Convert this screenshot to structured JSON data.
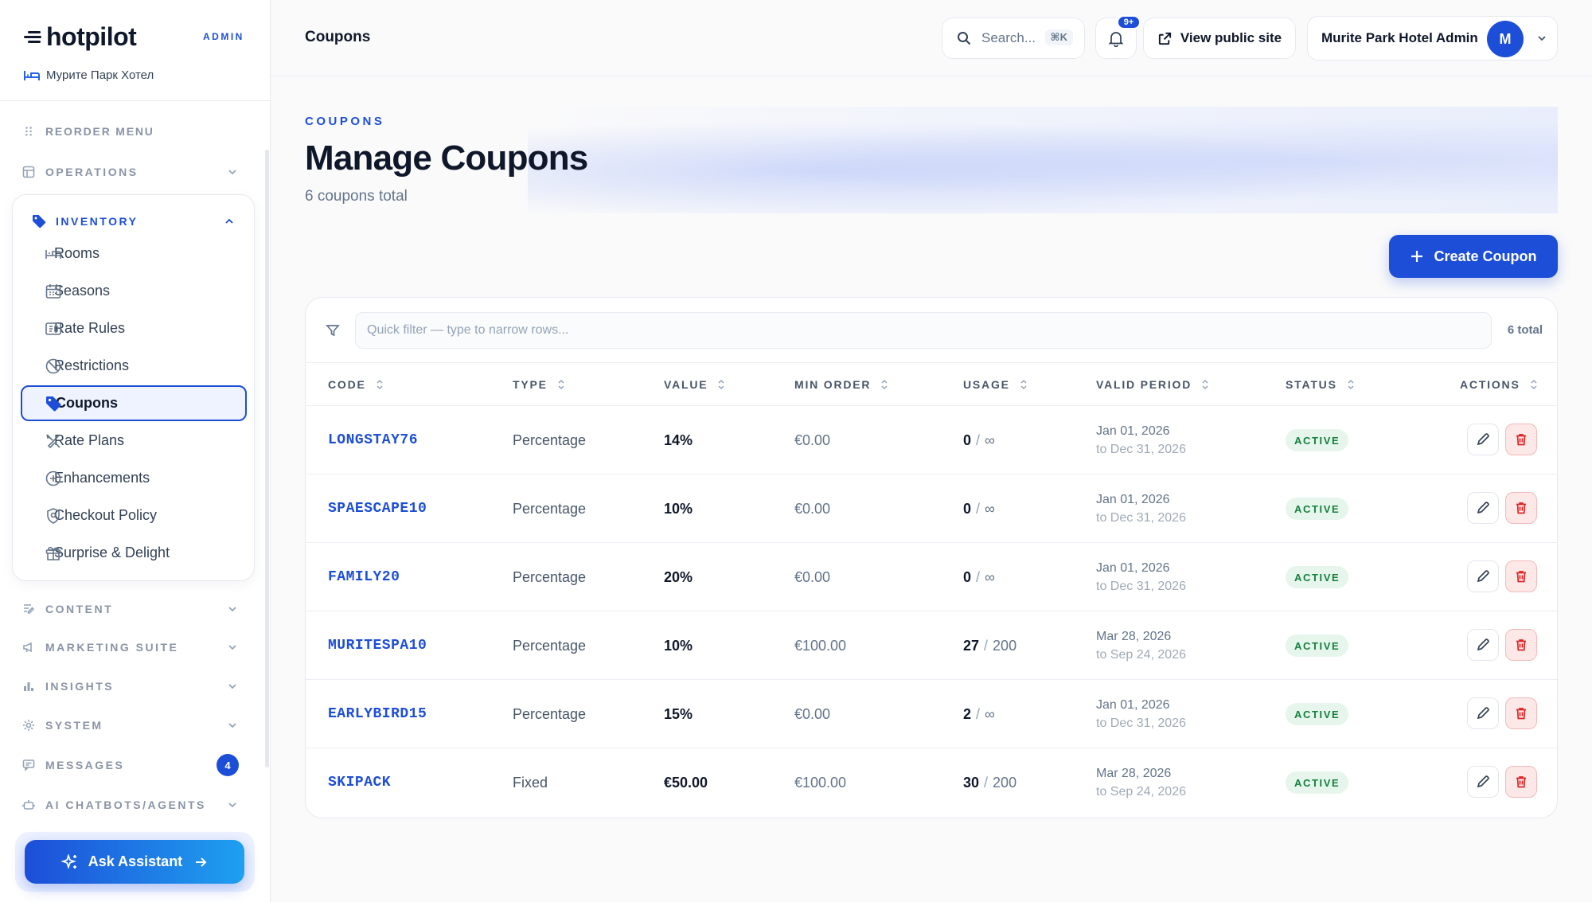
{
  "brand": {
    "name": "hotpilot",
    "role": "ADMIN",
    "hotel": "Мурите Парк Хотел"
  },
  "sidebar": {
    "reorder": "REORDER MENU",
    "sections": {
      "operations": "OPERATIONS",
      "inventory": "INVENTORY",
      "content": "CONTENT",
      "marketing": "MARKETING SUITE",
      "insights": "INSIGHTS",
      "system": "SYSTEM",
      "messages": "MESSAGES",
      "ai": "AI CHATBOTS/AGENTS"
    },
    "messages_badge": "4",
    "inventory_items": {
      "rooms": "Rooms",
      "seasons": "Seasons",
      "rate_rules": "Rate Rules",
      "restrictions": "Restrictions",
      "coupons": "Coupons",
      "rate_plans": "Rate Plans",
      "enhancements": "Enhancements",
      "checkout_policy": "Checkout Policy",
      "surprise": "Surprise & Delight"
    },
    "assistant_label": "Ask Assistant"
  },
  "topbar": {
    "page": "Coupons",
    "search_placeholder": "Search...",
    "search_shortcut": "⌘K",
    "notifications_badge": "9+",
    "view_site": "View public site",
    "account_name": "Murite Park Hotel Admin",
    "avatar_initial": "M"
  },
  "hero": {
    "eyebrow": "COUPONS",
    "title": "Manage Coupons",
    "subtitle": "6 coupons total"
  },
  "create_label": "Create Coupon",
  "filter": {
    "placeholder": "Quick filter — type to narrow rows...",
    "count": "6 total"
  },
  "columns": {
    "code": "CODE",
    "type": "TYPE",
    "value": "VALUE",
    "min_order": "MIN ORDER",
    "usage": "USAGE",
    "valid_period": "VALID PERIOD",
    "status": "STATUS",
    "actions": "ACTIONS"
  },
  "rows": [
    {
      "code": "LONGSTAY76",
      "type": "Percentage",
      "value": "14%",
      "min_order": "€0.00",
      "used": "0",
      "limit": "∞",
      "from": "Jan 01, 2026",
      "to": "to Dec 31, 2026",
      "status": "ACTIVE"
    },
    {
      "code": "SPAESCAPE10",
      "type": "Percentage",
      "value": "10%",
      "min_order": "€0.00",
      "used": "0",
      "limit": "∞",
      "from": "Jan 01, 2026",
      "to": "to Dec 31, 2026",
      "status": "ACTIVE"
    },
    {
      "code": "FAMILY20",
      "type": "Percentage",
      "value": "20%",
      "min_order": "€0.00",
      "used": "0",
      "limit": "∞",
      "from": "Jan 01, 2026",
      "to": "to Dec 31, 2026",
      "status": "ACTIVE"
    },
    {
      "code": "MURITESPA10",
      "type": "Percentage",
      "value": "10%",
      "min_order": "€100.00",
      "used": "27",
      "limit": "200",
      "from": "Mar 28, 2026",
      "to": "to Sep 24, 2026",
      "status": "ACTIVE"
    },
    {
      "code": "EARLYBIRD15",
      "type": "Percentage",
      "value": "15%",
      "min_order": "€0.00",
      "used": "2",
      "limit": "∞",
      "from": "Jan 01, 2026",
      "to": "to Dec 31, 2026",
      "status": "ACTIVE"
    },
    {
      "code": "SKIPACK",
      "type": "Fixed",
      "value": "€50.00",
      "min_order": "€100.00",
      "used": "30",
      "limit": "200",
      "from": "Mar 28, 2026",
      "to": "to Sep 24, 2026",
      "status": "ACTIVE"
    }
  ]
}
